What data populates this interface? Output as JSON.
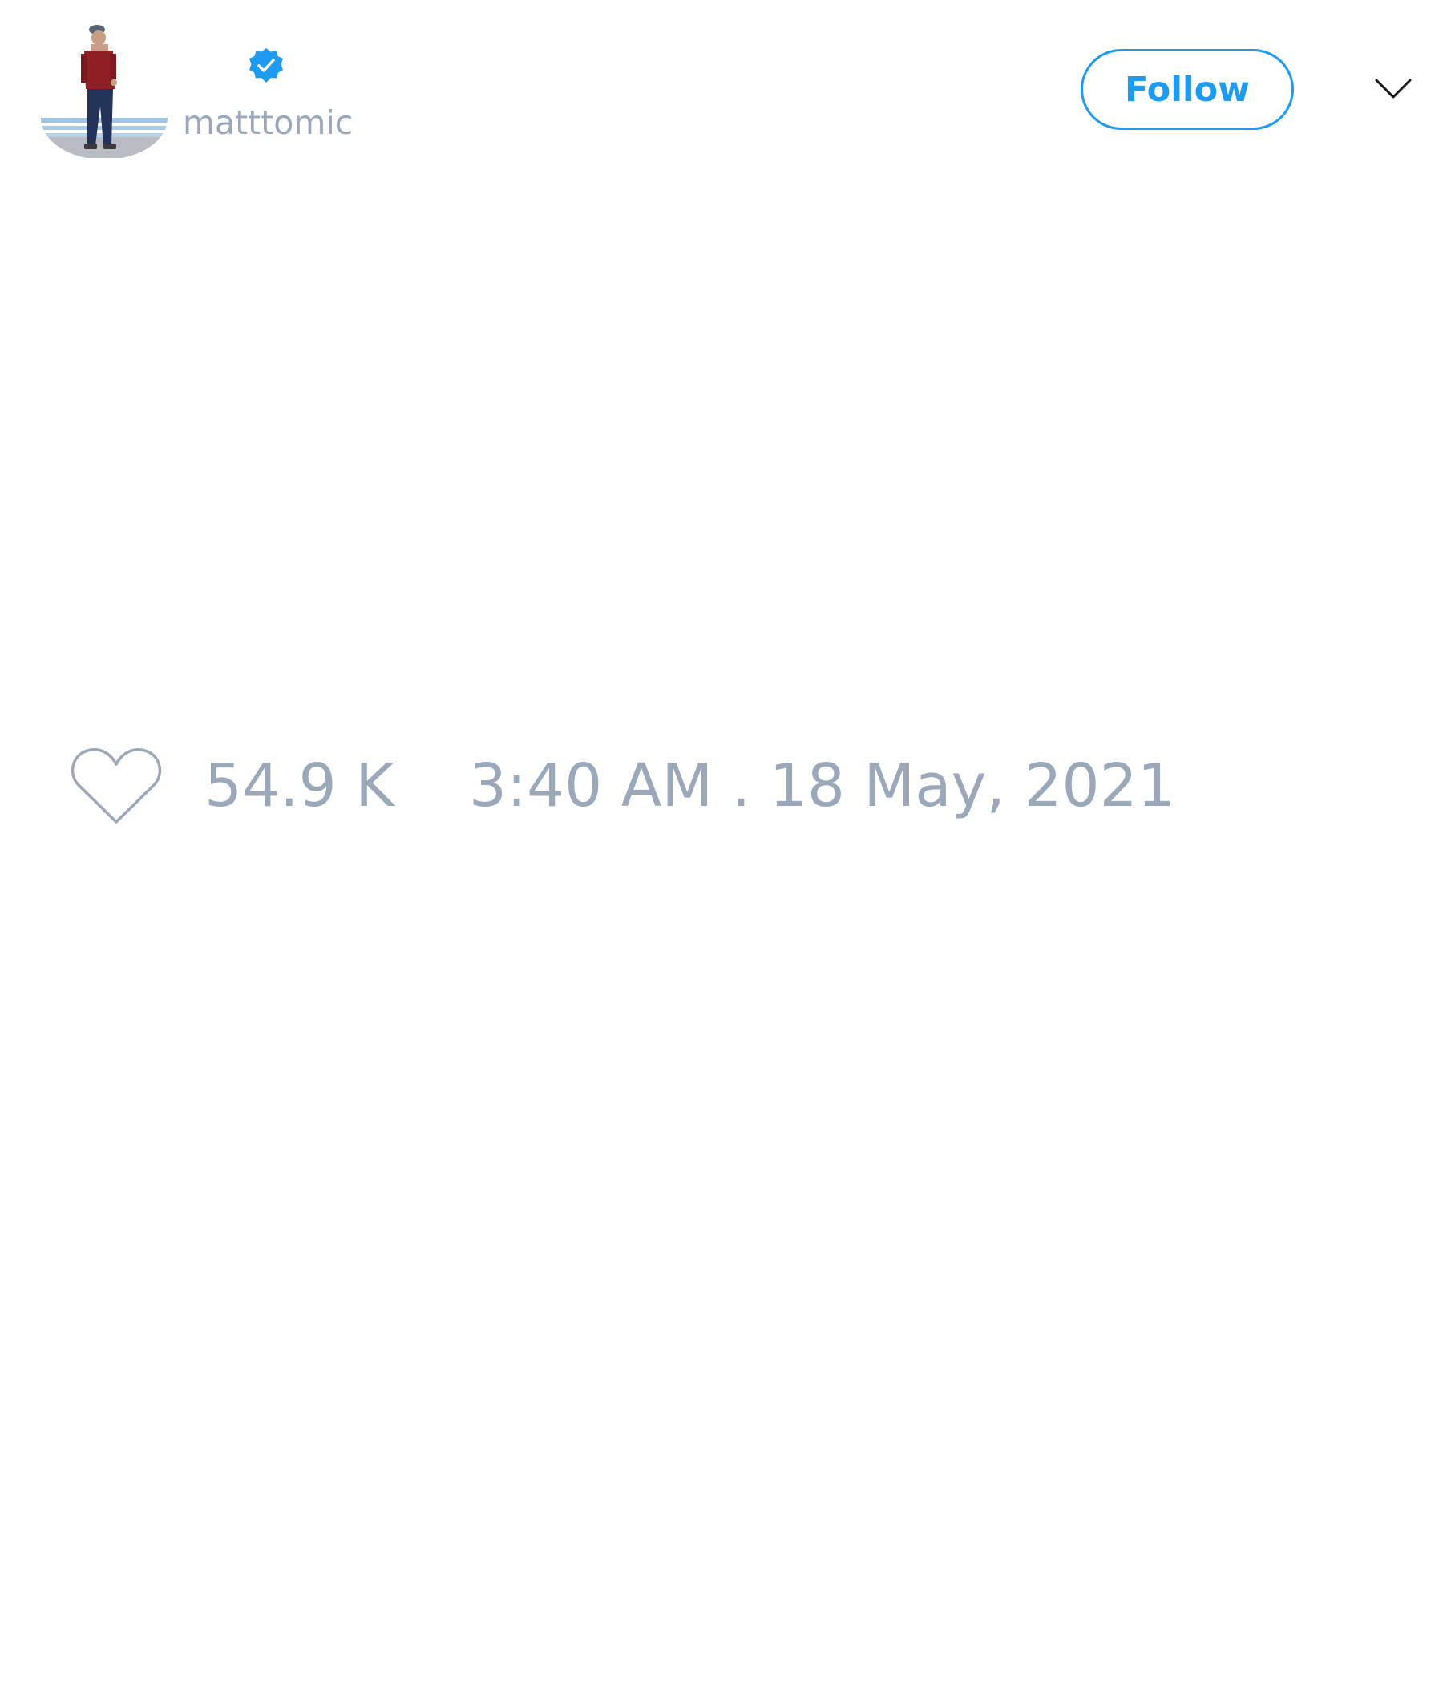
{
  "header": {
    "username": "matttomic",
    "verified_icon": "verified-badge-icon",
    "follow_label": "Follow",
    "menu_icon": "chevron-down-icon"
  },
  "engagement": {
    "like_icon": "heart-icon",
    "like_count": "54.9 K",
    "timestamp": "3:40 AM . 18 May, 2021"
  },
  "colors": {
    "accent": "#1d9bf0",
    "muted_text": "#9aa8ba",
    "background": "#ffffff"
  }
}
